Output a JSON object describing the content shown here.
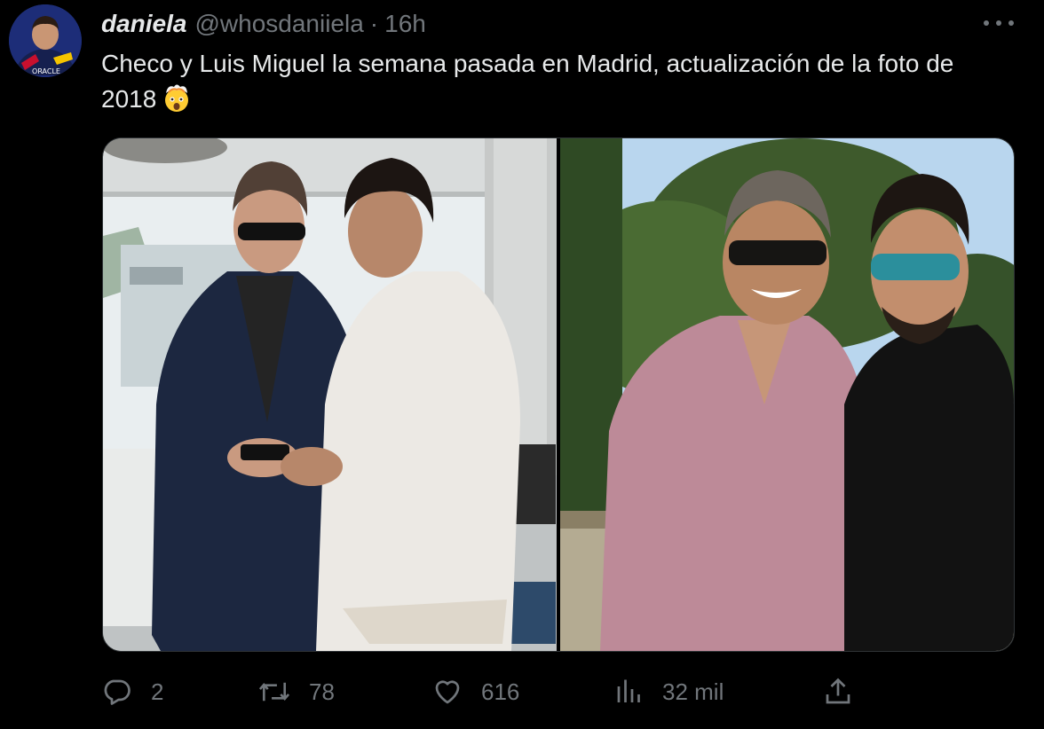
{
  "tweet": {
    "author": {
      "display_name": "daniela",
      "handle": "@whosdaniiela",
      "separator": "·",
      "time": "16h",
      "avatar_icon": "profile-avatar"
    },
    "text": "Checo y Luis Miguel la semana pasada en Madrid, actualización de la foto de 2018",
    "emoji": "exploding-head-emoji",
    "media": [
      {
        "name": "photo-left",
        "icon": "photo"
      },
      {
        "name": "photo-right",
        "icon": "photo"
      }
    ],
    "actions": {
      "replies": "2",
      "reposts": "78",
      "likes": "616",
      "views": "32 mil"
    }
  },
  "colors": {
    "background": "#000000",
    "text_primary": "#e7e9ea",
    "text_secondary": "#71767b",
    "border": "#2f3336"
  }
}
